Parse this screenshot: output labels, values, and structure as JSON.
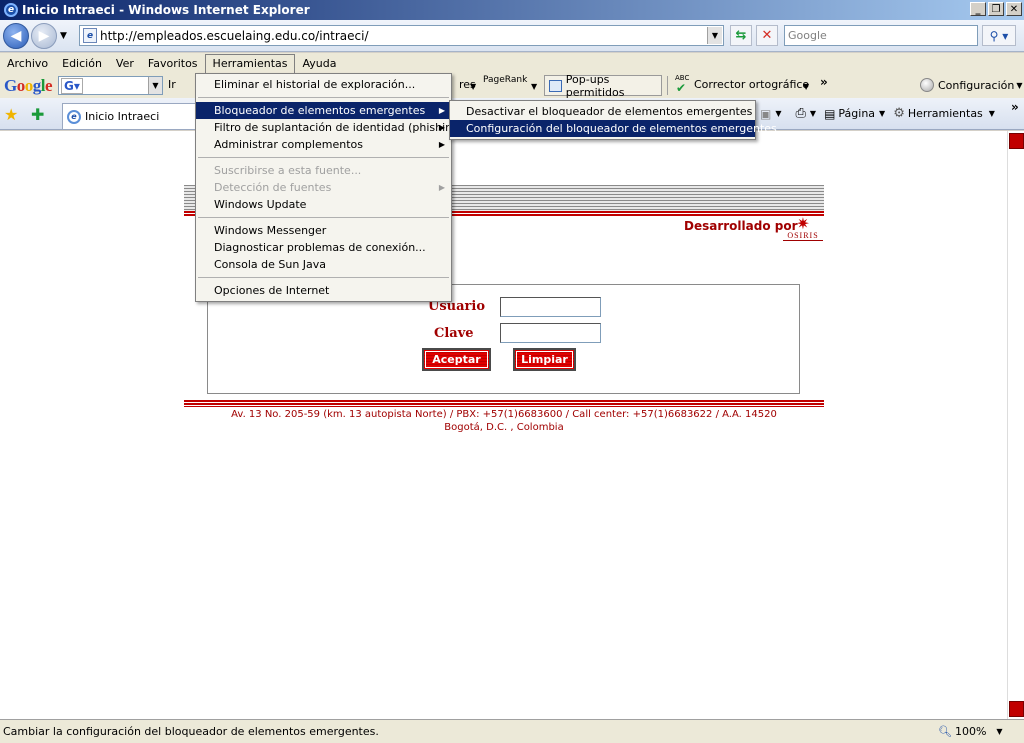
{
  "window": {
    "title": "Inicio Intraeci - Windows Internet Explorer",
    "min": "_",
    "max": "❐",
    "close": "✕"
  },
  "address": {
    "url": "http://empleados.escuelaing.edu.co/intraeci/",
    "search_placeholder": "Google"
  },
  "menubar": [
    "Archivo",
    "Edición",
    "Ver",
    "Favoritos",
    "Herramientas",
    "Ayuda"
  ],
  "google_toolbar": {
    "logo": [
      "G",
      "o",
      "o",
      "g",
      "l",
      "e"
    ],
    "go_label": "Ir",
    "bookmarks_fragment": "res",
    "pagerank_label": "PageRank",
    "popups_label": "Pop-ups permitidos",
    "spell_abc": "ABC",
    "spell_label": "Corrector ortográfico",
    "config_label": "Configuración"
  },
  "tabs": [
    {
      "label": "Inicio Intraeci"
    }
  ],
  "command_bar": {
    "page_label": "Página",
    "tools_label": "Herramientas"
  },
  "tools_menu": {
    "items": [
      {
        "label": "Eliminar el historial de exploración...",
        "state": "normal"
      },
      {
        "divider": true
      },
      {
        "label": "Bloqueador de elementos emergentes",
        "state": "highlighted",
        "submenu": true
      },
      {
        "label": "Filtro de suplantación de identidad (phishing)",
        "state": "normal",
        "submenu": true
      },
      {
        "label": "Administrar complementos",
        "state": "normal",
        "submenu": true
      },
      {
        "divider": true
      },
      {
        "label": "Suscribirse a esta fuente...",
        "state": "disabled"
      },
      {
        "label": "Detección de fuentes",
        "state": "disabled",
        "submenu": true
      },
      {
        "label": "Windows Update",
        "state": "normal"
      },
      {
        "divider": true
      },
      {
        "label": "Windows Messenger",
        "state": "normal"
      },
      {
        "label": "Diagnosticar problemas de conexión...",
        "state": "normal"
      },
      {
        "label": "Consola de Sun Java",
        "state": "normal"
      },
      {
        "divider": true
      },
      {
        "label": "Opciones de Internet",
        "state": "normal"
      }
    ]
  },
  "popup_submenu": {
    "items": [
      {
        "label": "Desactivar el bloqueador de elementos emergentes",
        "state": "normal"
      },
      {
        "label": "Configuración del bloqueador de elementos emergentes",
        "state": "highlighted"
      }
    ]
  },
  "page": {
    "developed_by": "Desarrollado por",
    "osiris": "OSIRIS",
    "usuario_label": "Usuario",
    "clave_label": "Clave",
    "accept_label": "Aceptar",
    "clear_label": "Limpiar",
    "footer_line1": "Av. 13 No. 205-59 (km. 13 autopista Norte) / PBX: +57(1)6683600 / Call center: +57(1)6683622 / A.A. 14520",
    "footer_line2": "Bogotá, D.C. , Colombia"
  },
  "status": {
    "text": "Cambiar la configuración del bloqueador de elementos emergentes.",
    "zoom": "100%"
  },
  "colors": {
    "accent_red": "#c00000",
    "menu_highlight": "#0a246a"
  }
}
